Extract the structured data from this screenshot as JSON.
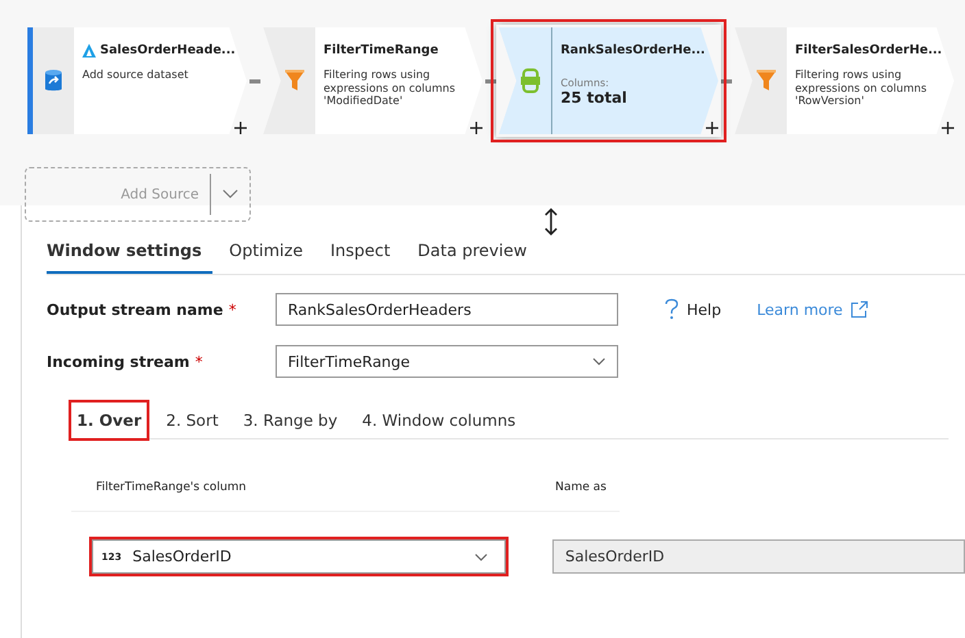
{
  "canvas": {
    "nodes": [
      {
        "kind": "source",
        "title": "SalesOrderHeade...",
        "description": "Add source dataset",
        "selected": false,
        "highlighted": false
      },
      {
        "kind": "filter",
        "title": "FilterTimeRange",
        "description": "Filtering rows using expressions on columns 'ModifiedDate'",
        "selected": false,
        "highlighted": false
      },
      {
        "kind": "window",
        "title": "RankSalesOrderHe...",
        "columns_label": "Columns:",
        "columns_value": "25 total",
        "selected": true,
        "highlighted": true
      },
      {
        "kind": "filter",
        "title": "FilterSalesOrderHe...",
        "description": "Filtering rows using expressions on columns 'RowVersion'",
        "selected": false,
        "highlighted": false
      }
    ],
    "add_source": "Add Source"
  },
  "tabs": [
    {
      "label": "Window settings",
      "selected": true
    },
    {
      "label": "Optimize",
      "selected": false
    },
    {
      "label": "Inspect",
      "selected": false
    },
    {
      "label": "Data preview",
      "selected": false
    }
  ],
  "form": {
    "output_stream": {
      "label": "Output stream name",
      "required_mark": "*",
      "value": "RankSalesOrderHeaders"
    },
    "incoming_stream": {
      "label": "Incoming stream",
      "required_mark": "*",
      "value": "FilterTimeRange"
    },
    "help": "Help",
    "learn_more": "Learn more"
  },
  "steps": [
    {
      "label": "1. Over",
      "selected": true,
      "highlighted": true
    },
    {
      "label": "2. Sort",
      "selected": false,
      "highlighted": false
    },
    {
      "label": "3. Range by",
      "selected": false,
      "highlighted": false
    },
    {
      "label": "4. Window columns",
      "selected": false,
      "highlighted": false
    }
  ],
  "over": {
    "columns": [
      "FilterTimeRange's column",
      "Name as"
    ],
    "rows": [
      {
        "type_badge": "123",
        "column": "SalesOrderID",
        "name_as": "SalesOrderID",
        "highlighted": true
      }
    ]
  }
}
